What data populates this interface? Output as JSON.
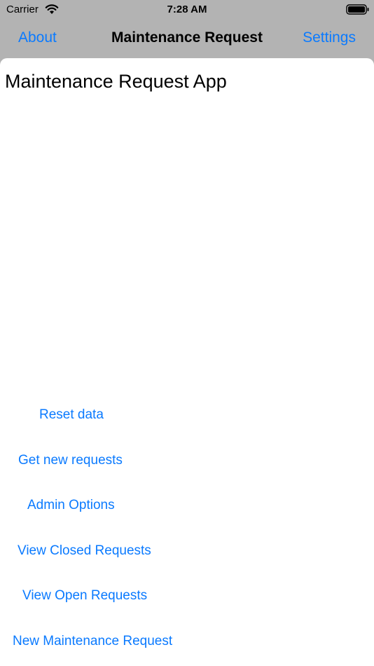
{
  "status_bar": {
    "carrier": "Carrier",
    "time": "7:28 AM"
  },
  "nav": {
    "left_label": "About",
    "title": "Maintenance Request",
    "right_label": "Settings"
  },
  "main": {
    "title": "Maintenance Request App",
    "actions": [
      {
        "label": "Reset data"
      },
      {
        "label": "Get new requests"
      },
      {
        "label": "Admin Options"
      },
      {
        "label": "View Closed Requests"
      },
      {
        "label": "View Open Requests"
      },
      {
        "label": "New Maintenance Request"
      }
    ]
  },
  "colors": {
    "accent": "#0a7aff",
    "nav_background": "#b3b3b3",
    "content_background": "#ffffff"
  }
}
